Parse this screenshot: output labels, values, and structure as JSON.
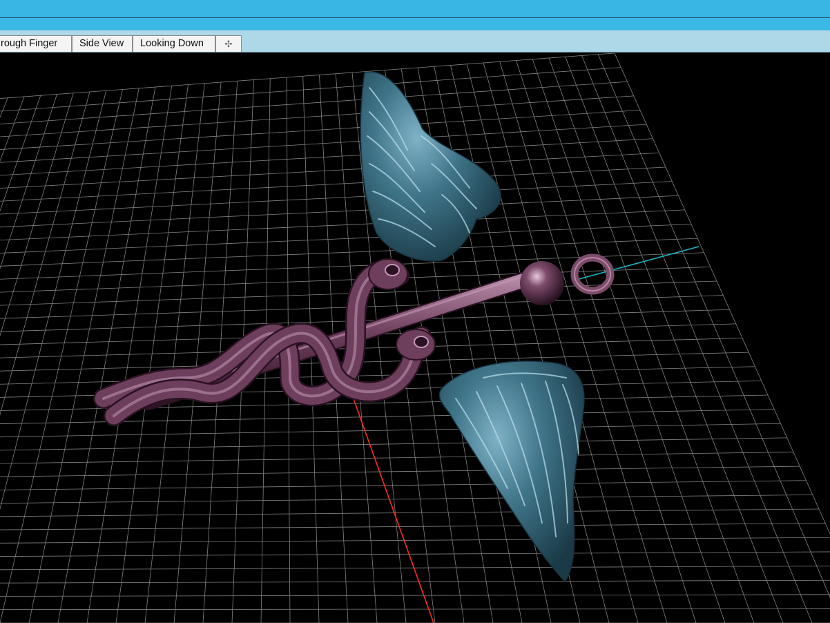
{
  "window": {
    "title_bar_color": "#39b6e4",
    "tab_bar_color": "#add8e8"
  },
  "view_tabs": [
    {
      "label": "rough Finger"
    },
    {
      "label": "Side View"
    },
    {
      "label": "Looking Down"
    }
  ],
  "add_tab_icon": "plus-icon",
  "viewport": {
    "background": "#000000",
    "grid_color": "#9a9a9a",
    "x_axis_color": "#ff2a2a",
    "y_axis_color": "#1bb6c4",
    "model_colors": {
      "wings": "#3b6e82",
      "staff_and_snakes": "#6e3f5c"
    }
  }
}
